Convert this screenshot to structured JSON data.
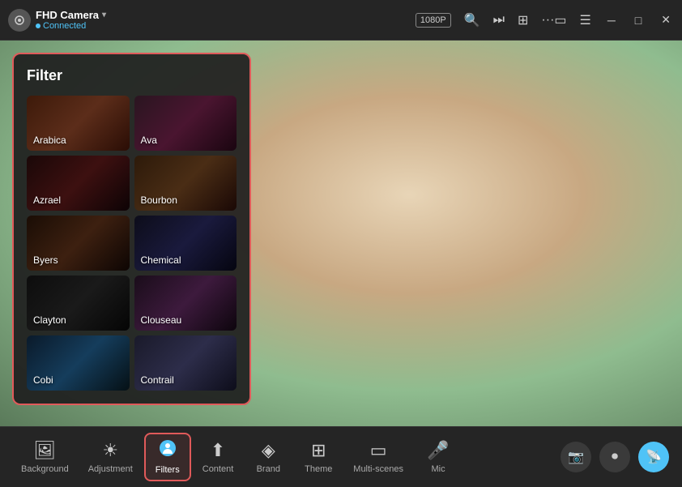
{
  "titlebar": {
    "app_name": "FHD Camera",
    "status": "Connected",
    "resolution": "1080P",
    "window_controls": [
      "minimize",
      "maximize",
      "close"
    ]
  },
  "filters": {
    "title": "Filter",
    "items": [
      {
        "id": "arabica",
        "label": "Arabica"
      },
      {
        "id": "ava",
        "label": "Ava"
      },
      {
        "id": "azrael",
        "label": "Azrael"
      },
      {
        "id": "bourbon",
        "label": "Bourbon"
      },
      {
        "id": "byers",
        "label": "Byers"
      },
      {
        "id": "chemical",
        "label": "Chemical"
      },
      {
        "id": "clayton",
        "label": "Clayton"
      },
      {
        "id": "clouseau",
        "label": "Clouseau"
      },
      {
        "id": "cobi",
        "label": "Cobi"
      },
      {
        "id": "contrail",
        "label": "Contrail"
      }
    ]
  },
  "toolbar": {
    "items": [
      {
        "id": "background",
        "label": "Background",
        "icon": "🖼"
      },
      {
        "id": "adjustment",
        "label": "Adjustment",
        "icon": "☀"
      },
      {
        "id": "filters",
        "label": "Filters",
        "icon": "👤",
        "active": true
      },
      {
        "id": "content",
        "label": "Content",
        "icon": "⬆"
      },
      {
        "id": "brand",
        "label": "Brand",
        "icon": "◈"
      },
      {
        "id": "theme",
        "label": "Theme",
        "icon": "⊞"
      },
      {
        "id": "multi-scenes",
        "label": "Multi-scenes",
        "icon": "▭"
      },
      {
        "id": "mic",
        "label": "Mic",
        "icon": "🎤"
      }
    ],
    "right_buttons": [
      {
        "id": "camera-snap",
        "icon": "📷",
        "active": false
      },
      {
        "id": "record",
        "icon": "⏺",
        "active": false
      },
      {
        "id": "live",
        "icon": "📡",
        "active": true
      }
    ]
  }
}
